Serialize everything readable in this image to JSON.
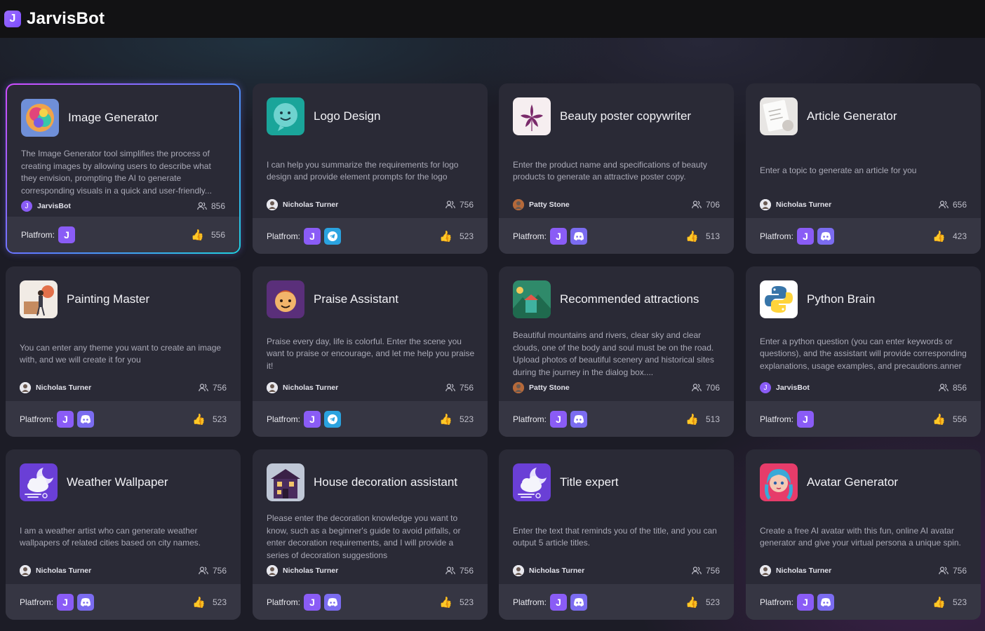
{
  "app": {
    "name": "JarvisBot",
    "logo_letter": "J"
  },
  "labels": {
    "platform": "Platfrom:"
  },
  "colors": {
    "accent": "#8a5cf6",
    "telegram": "#2aa3e0",
    "discord": "#7b6cf0",
    "like": "#f6b73c"
  },
  "cards": [
    {
      "title": "Image Generator",
      "icon": "colorful-brain-icon",
      "description": "The Image Generator tool simplifies the process of creating images by allowing users to describe what they envision, prompting the AI to generate corresponding visuals in a quick and user-friendly...",
      "author": "JarvisBot",
      "users": "856",
      "likes": "556",
      "platforms": [
        "jarvis"
      ],
      "selected": true
    },
    {
      "title": "Logo Design",
      "icon": "smiling-bubble-icon",
      "description": "I can help you summarize the requirements for logo design and provide element prompts for the logo",
      "author": "Nicholas Turner",
      "users": "756",
      "likes": "523",
      "platforms": [
        "jarvis",
        "telegram"
      ]
    },
    {
      "title": "Beauty poster copywriter",
      "icon": "flower-icon",
      "description": "Enter the product name and specifications of beauty products to generate an attractive poster copy.",
      "author": "Patty Stone",
      "users": "706",
      "likes": "513",
      "platforms": [
        "jarvis",
        "discord"
      ]
    },
    {
      "title": "Article Generator",
      "icon": "paper-note-icon",
      "description": "Enter a topic to generate an article for you",
      "author": "Nicholas Turner",
      "users": "656",
      "likes": "423",
      "platforms": [
        "jarvis",
        "discord"
      ]
    },
    {
      "title": "Painting Master",
      "icon": "painter-icon",
      "description": "You can enter any theme you want to create an image with, and we will create it for you",
      "author": "Nicholas Turner",
      "users": "756",
      "likes": "523",
      "platforms": [
        "jarvis",
        "discord"
      ]
    },
    {
      "title": "Praise Assistant",
      "icon": "cartoon-face-icon",
      "description": "Praise every day, life is colorful. Enter the scene you want to praise or encourage, and let me help you praise it!",
      "author": "Nicholas Turner",
      "users": "756",
      "likes": "523",
      "platforms": [
        "jarvis",
        "telegram"
      ]
    },
    {
      "title": "Recommended attractions",
      "icon": "landscape-icon",
      "description": "Beautiful mountains and rivers, clear sky and clear clouds, one of the body and soul must be on the road. Upload photos of beautiful scenery and historical sites during the journey in the dialog box....",
      "author": "Patty Stone",
      "users": "706",
      "likes": "513",
      "platforms": [
        "jarvis",
        "discord"
      ]
    },
    {
      "title": "Python Brain",
      "icon": "python-icon",
      "description": "Enter a python question (you can enter keywords or questions), and the assistant will provide corresponding explanations, usage examples, and precautions.anner",
      "author": "JarvisBot",
      "users": "856",
      "likes": "556",
      "platforms": [
        "jarvis"
      ]
    },
    {
      "title": "Weather Wallpaper",
      "icon": "cloud-moon-icon",
      "description": "I am a weather artist who can generate weather wallpapers of related cities based on city names.",
      "author": "Nicholas Turner",
      "users": "756",
      "likes": "523",
      "platforms": [
        "jarvis",
        "discord"
      ]
    },
    {
      "title": "House decoration assistant",
      "icon": "house-icon",
      "description": "Please enter the decoration knowledge you want to know, such as a beginner's guide to avoid pitfalls, or enter decoration requirements, and I will provide a series of decoration suggestions",
      "author": "Nicholas Turner",
      "users": "756",
      "likes": "523",
      "platforms": [
        "jarvis",
        "discord"
      ]
    },
    {
      "title": "Title expert",
      "icon": "cloud-moon-icon",
      "description": "Enter the text that reminds you of the title, and you can output 5 article titles.",
      "author": "Nicholas Turner",
      "users": "756",
      "likes": "523",
      "platforms": [
        "jarvis",
        "discord"
      ]
    },
    {
      "title": "Avatar Generator",
      "icon": "avatar-girl-icon",
      "description": "Create a free AI avatar with this fun, online AI avatar generator and give your virtual persona a unique spin.",
      "author": "Nicholas Turner",
      "users": "756",
      "likes": "523",
      "platforms": [
        "jarvis",
        "discord"
      ]
    }
  ]
}
